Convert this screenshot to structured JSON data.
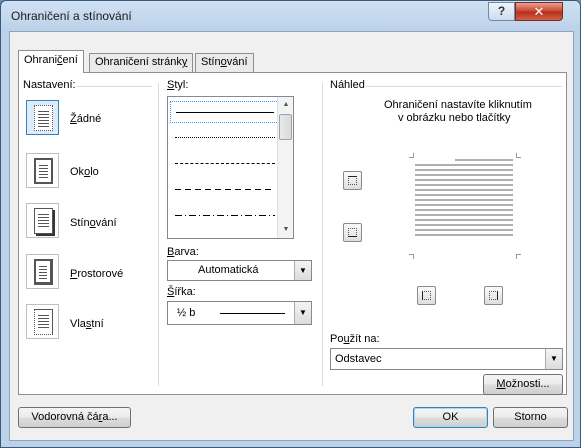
{
  "window": {
    "title": "Ohraničení a stínování"
  },
  "tabs": [
    {
      "label": "Ohraničení",
      "key": "h"
    },
    {
      "label": "Ohraničení stránky",
      "key": "y"
    },
    {
      "label": "Stínování",
      "key": "í"
    }
  ],
  "settings": {
    "label": "Nastavení:",
    "items": [
      {
        "label": "Žádné"
      },
      {
        "label": "Okolo"
      },
      {
        "label": "Stínování"
      },
      {
        "label": "Prostorové"
      },
      {
        "label": "Vlastní"
      }
    ],
    "selected": "Žádné"
  },
  "style": {
    "label": "Styl:",
    "items": [
      "solid",
      "dotted",
      "dashed-small",
      "dashed",
      "dash-dot"
    ]
  },
  "color": {
    "label": "Barva:",
    "value": "Automatická"
  },
  "width": {
    "label": "Šířka:",
    "value": "½ b"
  },
  "preview": {
    "label": "Náhled",
    "hint_line1": "Ohraničení nastavíte kliknutím",
    "hint_line2": "v obrázku nebo tlačítky"
  },
  "apply": {
    "label": "Použít na:",
    "value": "Odstavec"
  },
  "buttons": {
    "options": "Možnosti...",
    "horizontal_line": "Vodorovná čára...",
    "ok": "OK",
    "cancel": "Storno"
  }
}
